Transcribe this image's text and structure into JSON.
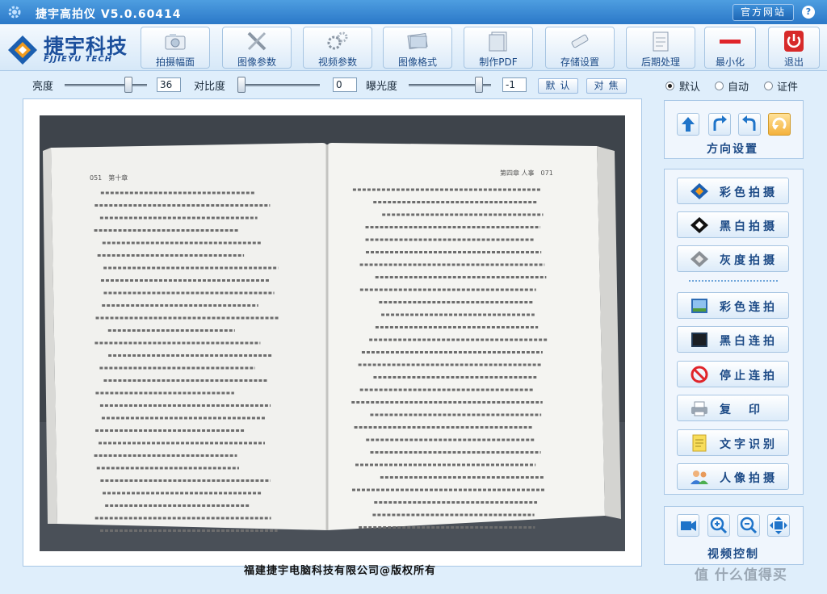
{
  "window": {
    "title": "捷宇高拍仪  V5.0.60414",
    "site_button": "官方网站",
    "help": "?"
  },
  "logo": {
    "brand": "捷宇科技",
    "sub": "FJJIEYU TECH"
  },
  "toolbar": [
    {
      "id": "capture-size",
      "label": "拍摄幅面",
      "icon": "camera-icon"
    },
    {
      "id": "image-params",
      "label": "图像参数",
      "icon": "tools-icon"
    },
    {
      "id": "video-params",
      "label": "视频参数",
      "icon": "gears-icon"
    },
    {
      "id": "image-format",
      "label": "图像格式",
      "icon": "image-stack-icon"
    },
    {
      "id": "make-pdf",
      "label": "制作PDF",
      "icon": "pdf-icon"
    },
    {
      "id": "storage",
      "label": "存储设置",
      "icon": "usb-drive-icon"
    },
    {
      "id": "post-process",
      "label": "后期处理",
      "icon": "notepad-icon"
    },
    {
      "id": "minimize",
      "label": "最小化",
      "icon": "minus-icon"
    },
    {
      "id": "exit",
      "label": "退出",
      "icon": "power-icon"
    }
  ],
  "controls": {
    "brightness_label": "亮度",
    "brightness_value": "36",
    "contrast_label": "对比度",
    "contrast_value": "0",
    "exposure_label": "曝光度",
    "exposure_value": "-1",
    "default_button": "默认",
    "focus_button": "对焦"
  },
  "mode_options": [
    {
      "label": "默认",
      "selected": true
    },
    {
      "label": "自动",
      "selected": false
    },
    {
      "label": "证件",
      "selected": false
    }
  ],
  "direction": {
    "caption": "方向设置",
    "buttons": [
      "arrow-up-icon",
      "rotate-right-icon",
      "rotate-left-icon",
      "rotate-auto-icon"
    ]
  },
  "capture_buttons": [
    {
      "label": "彩色拍摄",
      "icon": "color-capture-icon"
    },
    {
      "label": "黑白拍摄",
      "icon": "bw-capture-icon"
    },
    {
      "label": "灰度拍摄",
      "icon": "gray-capture-icon"
    }
  ],
  "continuous_buttons": [
    {
      "label": "彩色连拍",
      "icon": "color-burst-icon"
    },
    {
      "label": "黑白连拍",
      "icon": "bw-burst-icon"
    },
    {
      "label": "停止连拍",
      "icon": "stop-icon"
    },
    {
      "label": "复　印",
      "icon": "printer-icon"
    },
    {
      "label": "文字识别",
      "icon": "document-icon"
    },
    {
      "label": "人像拍摄",
      "icon": "people-icon"
    }
  ],
  "video_control": {
    "caption": "视频控制",
    "buttons": [
      "video-camera-icon",
      "zoom-in-icon",
      "zoom-out-icon",
      "fit-screen-icon"
    ]
  },
  "footer": {
    "copyright": "福建捷宇电脑科技有限公司@版权所有"
  },
  "watermark": "值 什么值得买",
  "book": {
    "left_header": "051　第十章",
    "right_header": "第四章 人事　071"
  },
  "colors": {
    "accent": "#2b78c8",
    "brand": "#1c4f9c",
    "panel": "#dfeefb"
  }
}
